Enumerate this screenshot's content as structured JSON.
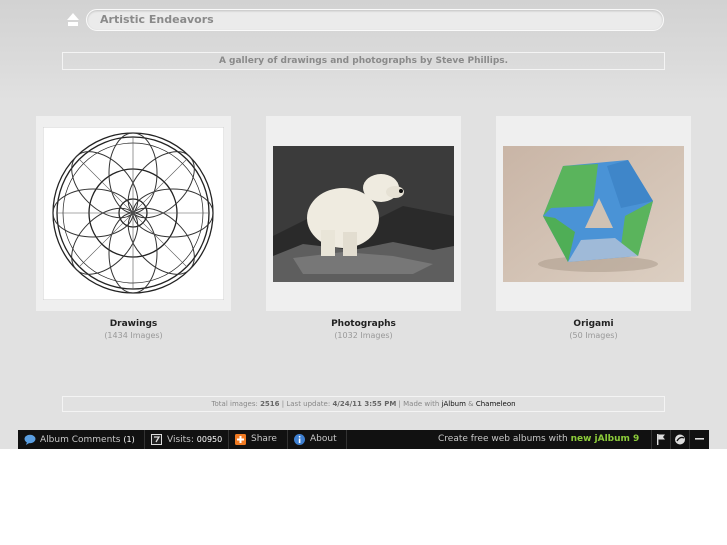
{
  "header": {
    "title": "Artistic Endeavors",
    "description": "A gallery of drawings and photographs by Steve Phillips."
  },
  "folders": [
    {
      "name": "Drawings",
      "count": "(1434 Images)",
      "thumb_icon": "mandala-drawing-thumbnail"
    },
    {
      "name": "Photographs",
      "count": "(1032 Images)",
      "thumb_icon": "polar-bear-photo-thumbnail"
    },
    {
      "name": "Origami",
      "count": "(50 Images)",
      "thumb_icon": "origami-photo-thumbnail"
    }
  ],
  "footer": {
    "total_label": "Total images:",
    "total_value": "2516",
    "update_label": "| Last update:",
    "update_value": "4/24/11 3:55 PM",
    "made_label": "| Made with",
    "made_link1": "jAlbum",
    "made_amp": "&",
    "made_link2": "Chameleon"
  },
  "toolbar": {
    "comments_label": "Album Comments",
    "comments_count": "(1)",
    "visits_label": "Visits:",
    "visits_value": "00950",
    "share_label": "Share",
    "about_label": "About",
    "promo_text": "Create free web albums with",
    "promo_link": "new jAlbum 9"
  },
  "colors": {
    "toolbar_bg": "#111111",
    "promo_accent": "#8ccc3a",
    "page_bg": "#e1e1e1"
  }
}
